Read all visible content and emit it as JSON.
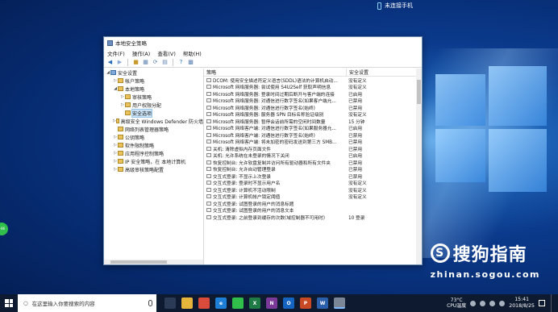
{
  "desktop": {
    "notification": "未连接手机",
    "green_badge": "+86"
  },
  "window": {
    "title": "本地安全策略",
    "menu": [
      "文件(F)",
      "操作(A)",
      "查看(V)",
      "帮助(H)"
    ],
    "tree": [
      {
        "label": "安全设置",
        "level": 0,
        "twisty": "open",
        "icon": "security-settings-icon"
      },
      {
        "label": "帐户策略",
        "level": 1,
        "twisty": "closed",
        "icon": "folder-icon"
      },
      {
        "label": "本地策略",
        "level": 1,
        "twisty": "open",
        "icon": "folder-icon"
      },
      {
        "label": "审核策略",
        "level": 2,
        "twisty": "closed",
        "icon": "folder-icon"
      },
      {
        "label": "用户权限分配",
        "level": 2,
        "twisty": "closed",
        "icon": "folder-icon"
      },
      {
        "label": "安全选项",
        "level": 2,
        "twisty": "",
        "icon": "folder-icon",
        "selected": true
      },
      {
        "label": "高级安全 Windows Defender 防火墙",
        "level": 1,
        "twisty": "closed",
        "icon": "folder-icon"
      },
      {
        "label": "网络列表管理器策略",
        "level": 1,
        "twisty": "",
        "icon": "folder-icon"
      },
      {
        "label": "公钥策略",
        "level": 1,
        "twisty": "closed",
        "icon": "folder-icon"
      },
      {
        "label": "软件限制策略",
        "level": 1,
        "twisty": "closed",
        "icon": "folder-icon"
      },
      {
        "label": "应用程序控制策略",
        "level": 1,
        "twisty": "closed",
        "icon": "folder-icon"
      },
      {
        "label": "IP 安全策略，在 本地计算机",
        "level": 1,
        "twisty": "closed",
        "icon": "ip-policy-icon"
      },
      {
        "label": "高级审核策略配置",
        "level": 1,
        "twisty": "closed",
        "icon": "folder-icon"
      }
    ],
    "columns": {
      "policy": "策略",
      "setting": "安全设置"
    },
    "policies": [
      {
        "policy": "DCOM: 使用安全描述符定义语言(SDDL)语法的计算机启动...",
        "setting": "没有定义"
      },
      {
        "policy": "Microsoft 网络服务器: 尝试使用 S4U2Self 获取声明信息",
        "setting": "没有定义"
      },
      {
        "policy": "Microsoft 网络服务器: 登录时间过期后断开与客户端的连接",
        "setting": "已启用"
      },
      {
        "policy": "Microsoft 网络服务器: 对通信进行数字签名(如果客户端允...",
        "setting": "已禁用"
      },
      {
        "policy": "Microsoft 网络服务器: 对通信进行数字签名(始终)",
        "setting": "已禁用"
      },
      {
        "policy": "Microsoft 网络服务器: 服务器 SPN 目标名称验证级别",
        "setting": "没有定义"
      },
      {
        "policy": "Microsoft 网络服务器: 暂停会话前所需的空闲时间数量",
        "setting": "15 分钟"
      },
      {
        "policy": "Microsoft 网络客户端: 对通信进行数字签名(如果服务器允...",
        "setting": "已启用"
      },
      {
        "policy": "Microsoft 网络客户端: 对通信进行数字签名(始终)",
        "setting": "已禁用"
      },
      {
        "policy": "Microsoft 网络客户端: 将未加密的密码发送到第三方 SMB...",
        "setting": "已禁用"
      },
      {
        "policy": "关机: 清除虚拟内存页面文件",
        "setting": "已禁用"
      },
      {
        "policy": "关机: 允许系统在未登录的情况下关闭",
        "setting": "已启用"
      },
      {
        "policy": "恢复控制台: 允许软盘复制并访问所有驱动器和所有文件夹",
        "setting": "已禁用"
      },
      {
        "policy": "恢复控制台: 允许自动管理登录",
        "setting": "已禁用"
      },
      {
        "policy": "交互式登录: 不显示上次登录",
        "setting": "已禁用"
      },
      {
        "policy": "交互式登录: 登录时不显示用户名",
        "setting": "没有定义"
      },
      {
        "policy": "交互式登录: 计算机不活动限制",
        "setting": "没有定义"
      },
      {
        "policy": "交互式登录: 计算机帐户锁定阈值",
        "setting": "没有定义"
      },
      {
        "policy": "交互式登录: 试图登录的用户的消息标题",
        "setting": ""
      },
      {
        "policy": "交互式登录: 试图登录的用户的消息文本",
        "setting": ""
      },
      {
        "policy": "交互式登录: 之前登录到缓存的次数(域控制器不可用时)",
        "setting": "10 登录"
      }
    ]
  },
  "taskbar": {
    "search_placeholder": "在这里输入你要搜索的内容",
    "apps": [
      {
        "name": "task-view-icon",
        "label": "",
        "color": "#2b3a55"
      },
      {
        "name": "file-explorer-icon",
        "label": "",
        "color": "#e8b53c"
      },
      {
        "name": "chrome-icon",
        "label": "",
        "color": "#d94b3a"
      },
      {
        "name": "edge-icon",
        "label": "e",
        "color": "#1e7fd6"
      },
      {
        "name": "wechat-icon",
        "label": "",
        "color": "#2fbf4a"
      },
      {
        "name": "excel-icon",
        "label": "X",
        "color": "#1f7a45"
      },
      {
        "name": "onenote-icon",
        "label": "N",
        "color": "#7b3a9a"
      },
      {
        "name": "outlook-icon",
        "label": "O",
        "color": "#1565c0"
      },
      {
        "name": "powerpoint-icon",
        "label": "P",
        "color": "#c84a25"
      },
      {
        "name": "word-icon",
        "label": "W",
        "color": "#2b5fab"
      },
      {
        "name": "security-policy-icon",
        "label": "",
        "color": "#7b8796"
      }
    ],
    "temp": "73°C",
    "temp_label": "CPU温度",
    "time": "15:41",
    "date": "2018/8/25"
  },
  "watermark": {
    "main": "搜狗指南",
    "sub": "zhinan.sogou.com"
  }
}
